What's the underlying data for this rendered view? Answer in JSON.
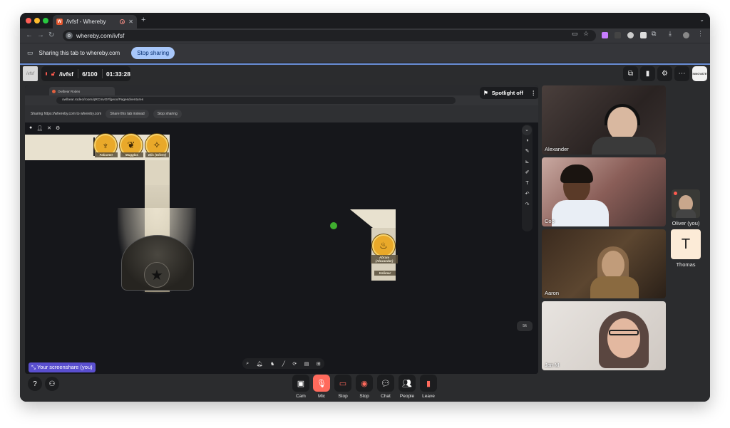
{
  "browser": {
    "tab_title": "/ivfsf - Whereby",
    "favicon_letter": "W",
    "url": "whereby.com/ivfsf",
    "sharing_text": "Sharing this tab to whereby.com",
    "stop_sharing": "Stop sharing"
  },
  "room": {
    "logo_text": "ivfsf",
    "name": "/ivfsf",
    "participants": "6/100",
    "timer": "01:33:28",
    "org_logo_text": "INNOVATE"
  },
  "screenshare": {
    "inner_tab_title": "Owlbear Rodeo",
    "inner_url": "owlbear.rodeo/room/qRCmvGFfgeox/Pagesdventures",
    "inner_sharing_text": "Sharing https://whereby.com to whereby.com",
    "share_instead": "Share this tab instead",
    "inner_stop": "Stop sharing",
    "spotlight": "Spotlight off",
    "label": "Your screenshare (you)",
    "scale": "5ft",
    "tokens": [
      {
        "label": "Falconer"
      },
      {
        "label": "Mugglas"
      },
      {
        "label": "Elic (Oliver)"
      },
      {
        "label": "Abram (Alexander)"
      },
      {
        "label": "Kalimar"
      }
    ]
  },
  "participants": [
    {
      "name": "Alexander"
    },
    {
      "name": "Coo"
    },
    {
      "name": "Aaron"
    },
    {
      "name": "Jan M"
    }
  ],
  "side_participants": [
    {
      "name": "Oliver (you)"
    },
    {
      "name": "Thomas",
      "initial": "T"
    }
  ],
  "controls": [
    {
      "label": "Cam"
    },
    {
      "label": "Mic"
    },
    {
      "label": "Stop"
    },
    {
      "label": "Stop"
    },
    {
      "label": "Chat"
    },
    {
      "label": "People"
    },
    {
      "label": "Leave"
    }
  ],
  "colors": {
    "mic_active": "#ff6a5c",
    "screenshare_label": "#5a4fcf",
    "stop_sharing_button": "#a8c7fa"
  }
}
